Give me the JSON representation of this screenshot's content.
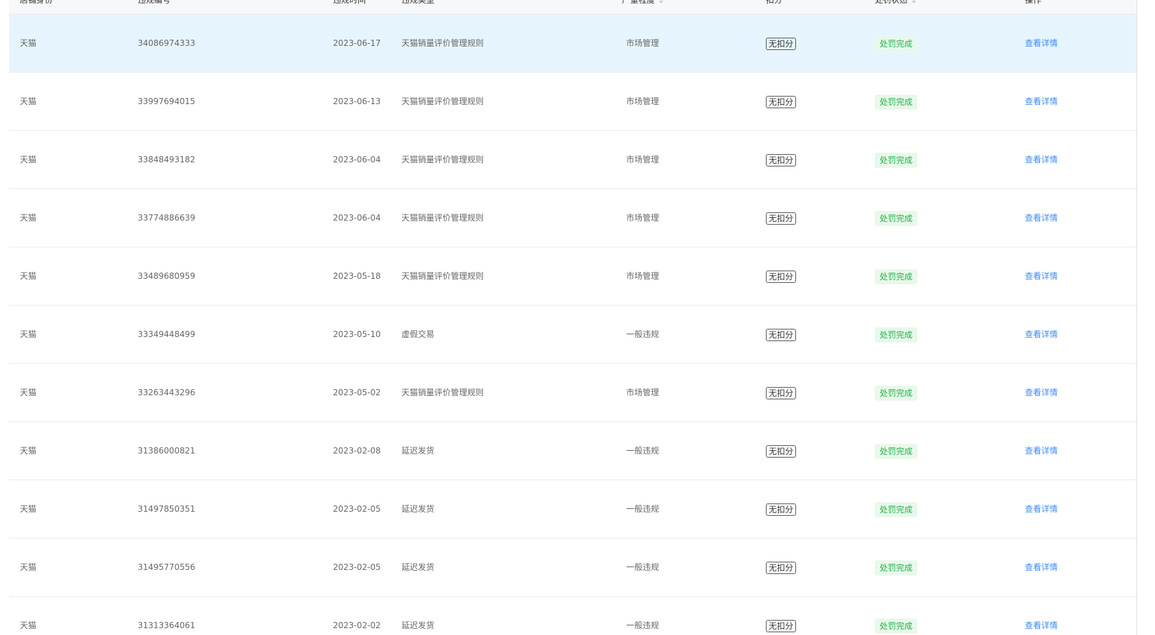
{
  "table": {
    "headers": {
      "store": "店铺身份",
      "id": "违规编号",
      "date": "违规时间",
      "type": "违规类型",
      "severity": "严重程度",
      "deduct": "扣分",
      "status": "处罚状态",
      "action": "操作"
    },
    "rows": [
      {
        "store": "天猫",
        "id": "34086974333",
        "date": "2023-06-17",
        "type": "天猫销量评价管理规则",
        "severity": "市场管理",
        "deduct": "无扣分",
        "status": "处罚完成",
        "action": "查看详情"
      },
      {
        "store": "天猫",
        "id": "33997694015",
        "date": "2023-06-13",
        "type": "天猫销量评价管理规则",
        "severity": "市场管理",
        "deduct": "无扣分",
        "status": "处罚完成",
        "action": "查看详情"
      },
      {
        "store": "天猫",
        "id": "33848493182",
        "date": "2023-06-04",
        "type": "天猫销量评价管理规则",
        "severity": "市场管理",
        "deduct": "无扣分",
        "status": "处罚完成",
        "action": "查看详情"
      },
      {
        "store": "天猫",
        "id": "33774886639",
        "date": "2023-06-04",
        "type": "天猫销量评价管理规则",
        "severity": "市场管理",
        "deduct": "无扣分",
        "status": "处罚完成",
        "action": "查看详情"
      },
      {
        "store": "天猫",
        "id": "33489680959",
        "date": "2023-05-18",
        "type": "天猫销量评价管理规则",
        "severity": "市场管理",
        "deduct": "无扣分",
        "status": "处罚完成",
        "action": "查看详情"
      },
      {
        "store": "天猫",
        "id": "33349448499",
        "date": "2023-05-10",
        "type": "虚假交易",
        "severity": "一般违规",
        "deduct": "无扣分",
        "status": "处罚完成",
        "action": "查看详情"
      },
      {
        "store": "天猫",
        "id": "33263443296",
        "date": "2023-05-02",
        "type": "天猫销量评价管理规则",
        "severity": "市场管理",
        "deduct": "无扣分",
        "status": "处罚完成",
        "action": "查看详情"
      },
      {
        "store": "天猫",
        "id": "31386000821",
        "date": "2023-02-08",
        "type": "延迟发货",
        "severity": "一般违规",
        "deduct": "无扣分",
        "status": "处罚完成",
        "action": "查看详情"
      },
      {
        "store": "天猫",
        "id": "31497850351",
        "date": "2023-02-05",
        "type": "延迟发货",
        "severity": "一般违规",
        "deduct": "无扣分",
        "status": "处罚完成",
        "action": "查看详情"
      },
      {
        "store": "天猫",
        "id": "31495770556",
        "date": "2023-02-05",
        "type": "延迟发货",
        "severity": "一般违规",
        "deduct": "无扣分",
        "status": "处罚完成",
        "action": "查看详情"
      },
      {
        "store": "天猫",
        "id": "31313364061",
        "date": "2023-02-02",
        "type": "延迟发货",
        "severity": "一般违规",
        "deduct": "无扣分",
        "status": "处罚完成",
        "action": "查看详情"
      }
    ]
  },
  "colors": {
    "highlight_row": "#e6f5fd",
    "status_text": "#22b24c",
    "status_bg": "#e8f8ea",
    "link": "#3d8bf2"
  },
  "icons": {
    "sort": "sort-icon"
  }
}
